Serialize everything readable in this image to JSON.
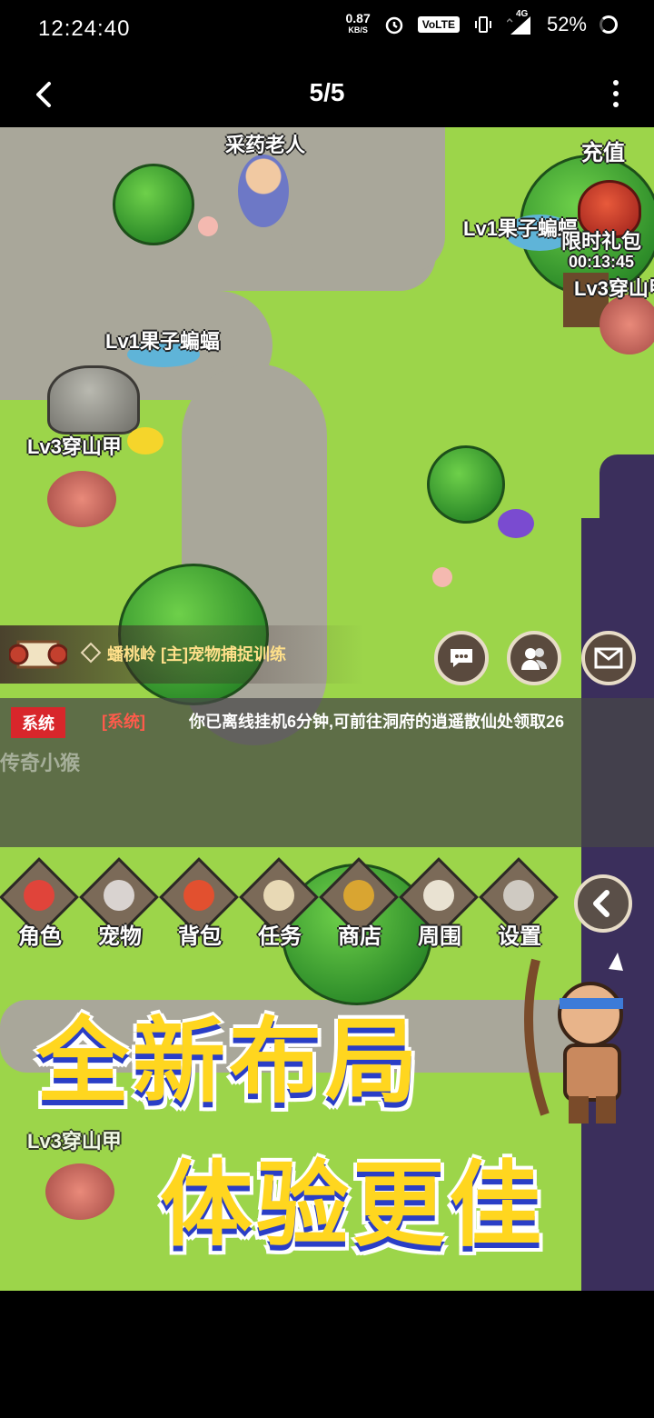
{
  "status_bar": {
    "time": "12:24:40",
    "speed_value": "0.87",
    "speed_unit": "KB/S",
    "volte": "VoLTE",
    "network": "4G",
    "battery": "52%"
  },
  "title_bar": {
    "pager": "5/5"
  },
  "game": {
    "top_right": {
      "recharge": "充值",
      "gift_label": "限时礼包",
      "gift_timer": "00:13:45"
    },
    "labels": {
      "npc_top": "采药老人",
      "bat_right": "Lv1果子蝙蝠",
      "armadillo_right": "Lv3穿山甲",
      "bat_left": "Lv1果子蝙蝠",
      "armadillo_left": "Lv3穿山甲",
      "monkey": "传奇小猴",
      "armadillo_bottom": "Lv3穿山甲"
    },
    "quest": {
      "text": "蟠桃岭 [主]宠物捕捉训练"
    },
    "chat": {
      "badge": "系统",
      "tag": "[系统]",
      "message": "你已离线挂机6分钟,可前往洞府的逍遥散仙处领取26"
    },
    "menu": [
      {
        "label": "角色"
      },
      {
        "label": "宠物"
      },
      {
        "label": "背包"
      },
      {
        "label": "任务"
      },
      {
        "label": "商店"
      },
      {
        "label": "周围"
      },
      {
        "label": "设置"
      }
    ],
    "promo": {
      "line1": "全新布局",
      "line2": "体验更佳"
    }
  },
  "colors": {
    "grass": "#9cd54a",
    "path": "#a9a79a",
    "promo_yellow": "#ffd61f",
    "promo_blue": "#2a3ec6",
    "system_red": "#d8262b"
  }
}
